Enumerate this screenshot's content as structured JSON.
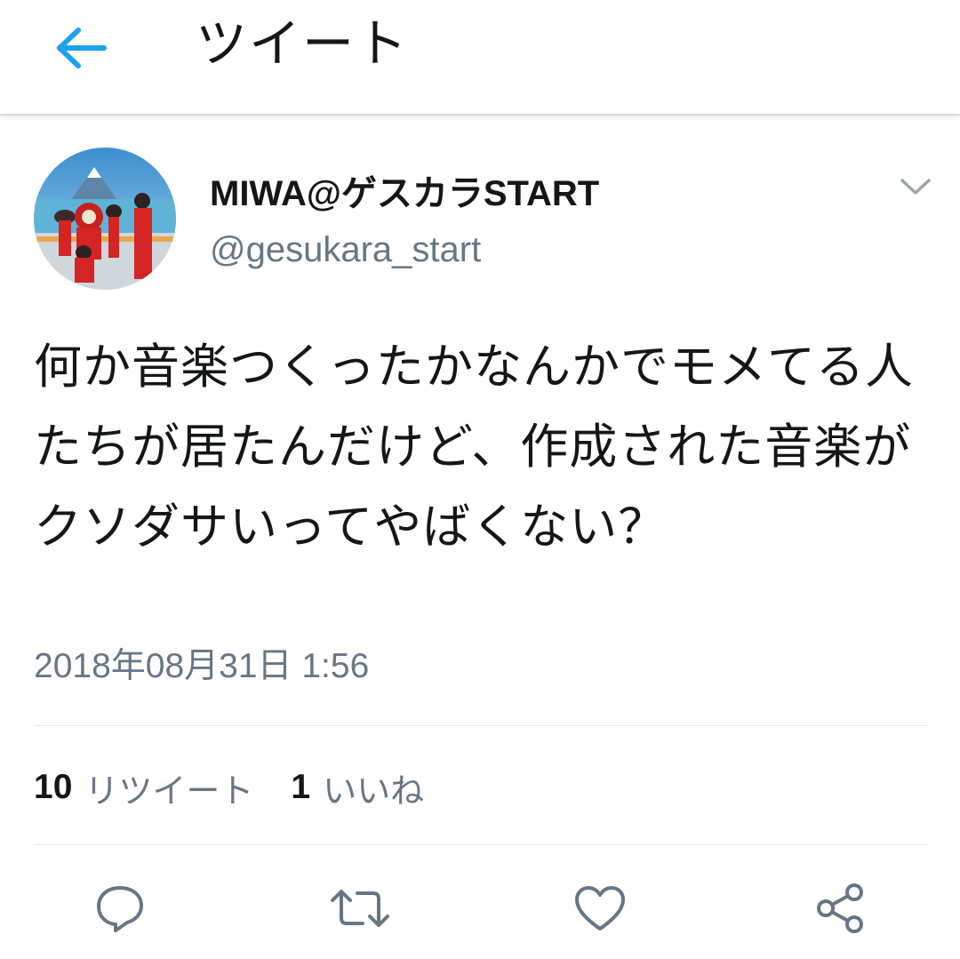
{
  "header": {
    "back_icon": "arrow-left-icon",
    "title": "ツイート",
    "accent_color": "#1da1f2"
  },
  "tweet": {
    "author": {
      "display_name": "MIWA@ゲスカラSTART",
      "handle": "@gesukara_start",
      "avatar": "profile-photo"
    },
    "menu_icon": "chevron-down-icon",
    "text": "何か音楽つくったかなんかでモメてる人たちが居たんだけど、作成された音楽がクソダサいってやばくない？",
    "timestamp": "2018年08月31日 1:56",
    "stats": {
      "retweets_count": "10",
      "retweets_label": "リツイート",
      "likes_count": "1",
      "likes_label": "いいね"
    },
    "actions": [
      {
        "name": "reply",
        "icon": "reply-icon"
      },
      {
        "name": "retweet",
        "icon": "retweet-icon"
      },
      {
        "name": "like",
        "icon": "heart-icon"
      },
      {
        "name": "share",
        "icon": "share-icon"
      }
    ]
  },
  "colors": {
    "text_primary": "#14171a",
    "text_secondary": "#657786",
    "divider": "#e1e8ed",
    "icon": "#657786"
  }
}
